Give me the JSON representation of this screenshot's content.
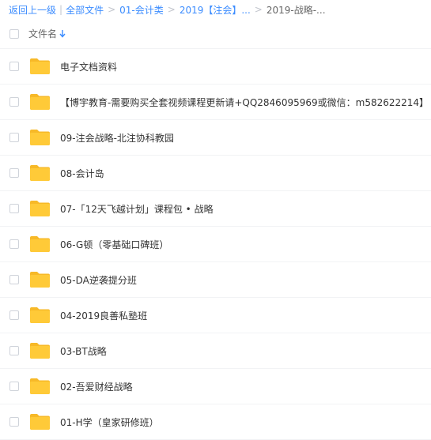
{
  "breadcrumb": {
    "back": "返回上一级",
    "all_files": "全部文件",
    "crumb1": "01-会计类",
    "crumb2": "2019【注会】...",
    "current": "2019-战略-..."
  },
  "header": {
    "column_label": "文件名"
  },
  "colors": {
    "link": "#3b8cff",
    "folder": "#ffca38",
    "folder_tab": "#f7b928"
  },
  "rows": [
    {
      "name": "电子文档资料"
    },
    {
      "name": "【博宇教育-需要购买全套视频课程更新请+QQ2846095969或微信：m582622214】"
    },
    {
      "name": "09-注会战略-北注协科教园"
    },
    {
      "name": "08-会计岛"
    },
    {
      "name": "07-「12天飞越计划」课程包 • 战略"
    },
    {
      "name": "06-G顿（零基础口碑班）"
    },
    {
      "name": "05-DA逆袭提分班"
    },
    {
      "name": "04-2019良善私塾班"
    },
    {
      "name": "03-BT战略"
    },
    {
      "name": "02-吾爱财经战略"
    },
    {
      "name": "01-H学（皇家研修班）"
    }
  ]
}
